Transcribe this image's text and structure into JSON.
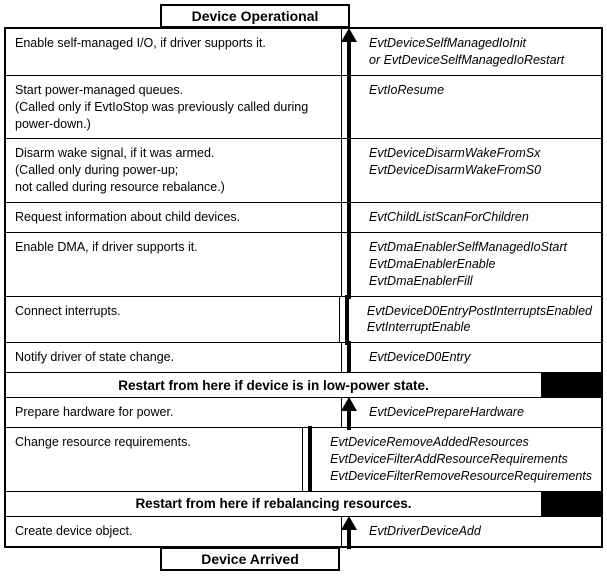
{
  "header": "Device Operational",
  "footer": "Device Arrived",
  "rows": [
    {
      "left": "Enable self-managed I/O, if driver supports it.",
      "right": "EvtDeviceSelfManagedIoInit\nor EvtDeviceSelfManagedIoRestart",
      "arrow": "head"
    },
    {
      "left": "Start power-managed queues.\n(Called only if EvtIoStop was previously called during power-down.)",
      "right": "EvtIoResume",
      "arrow": "shaft"
    },
    {
      "left": "Disarm wake signal, if it was armed.\n(Called only during power-up;\nnot called during resource rebalance.)",
      "right": "EvtDeviceDisarmWakeFromSx\nEvtDeviceDisarmWakeFromS0",
      "arrow": "shaft"
    },
    {
      "left": "Request information about child devices.",
      "right": "EvtChildListScanForChildren",
      "arrow": "shaft"
    },
    {
      "left": "Enable DMA, if driver supports it.",
      "right": "EvtDmaEnablerSelfManagedIoStart\nEvtDmaEnablerEnable\nEvtDmaEnablerFill",
      "arrow": "shaft"
    },
    {
      "left": "Connect interrupts.",
      "right": "EvtDeviceD0EntryPostInterruptsEnabled\nEvtInterruptEnable",
      "arrow": "shaft"
    },
    {
      "left": "Notify driver of state change.",
      "right": "EvtDeviceD0Entry",
      "arrow": "shaft"
    }
  ],
  "banner1": "Restart from here if device is in low-power state.",
  "rows2": [
    {
      "left": "Prepare hardware for power.",
      "right": "EvtDevicePrepareHardware",
      "arrow": "head"
    },
    {
      "left": "Change resource requirements.",
      "right": "EvtDeviceRemoveAddedResources\nEvtDeviceFilterAddResourceRequirements\nEvtDeviceFilterRemoveResourceRequirements",
      "arrow": "shaft"
    }
  ],
  "banner2": "Restart from here if rebalancing resources.",
  "rows3": [
    {
      "left": "Create device object.",
      "right": "EvtDriverDeviceAdd",
      "arrow": "head"
    }
  ]
}
